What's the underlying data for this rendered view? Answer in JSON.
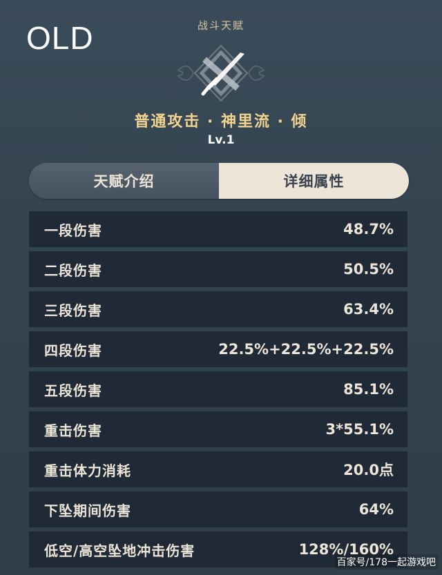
{
  "overlay": {
    "label": "OLD"
  },
  "header": {
    "section_title": "战斗天赋",
    "talent_name": "普通攻击 · 神里流 · 倾",
    "talent_level": "Lv.1",
    "emblem_icon": "sword-emblem-icon"
  },
  "tabs": [
    {
      "label": "天赋介绍",
      "selected": false
    },
    {
      "label": "详细属性",
      "selected": true
    }
  ],
  "attributes": [
    {
      "name": "一段伤害",
      "value": "48.7%"
    },
    {
      "name": "二段伤害",
      "value": "50.5%"
    },
    {
      "name": "三段伤害",
      "value": "63.4%"
    },
    {
      "name": "四段伤害",
      "value": "22.5%+22.5%+22.5%"
    },
    {
      "name": "五段伤害",
      "value": "85.1%"
    },
    {
      "name": "重击伤害",
      "value": "3*55.1%"
    },
    {
      "name": "重击体力消耗",
      "value": "20.0点"
    },
    {
      "name": "下坠期间伤害",
      "value": "64%"
    },
    {
      "name": "低空/高空坠地冲击伤害",
      "value": "128%/160%"
    }
  ],
  "watermark": "百家号/178一起游戏吧",
  "colors": {
    "background": "#33434f",
    "gold_text": "#f1d48f",
    "row_bg": "#1f2a36",
    "tab_selected_bg": "#ece5d8"
  }
}
